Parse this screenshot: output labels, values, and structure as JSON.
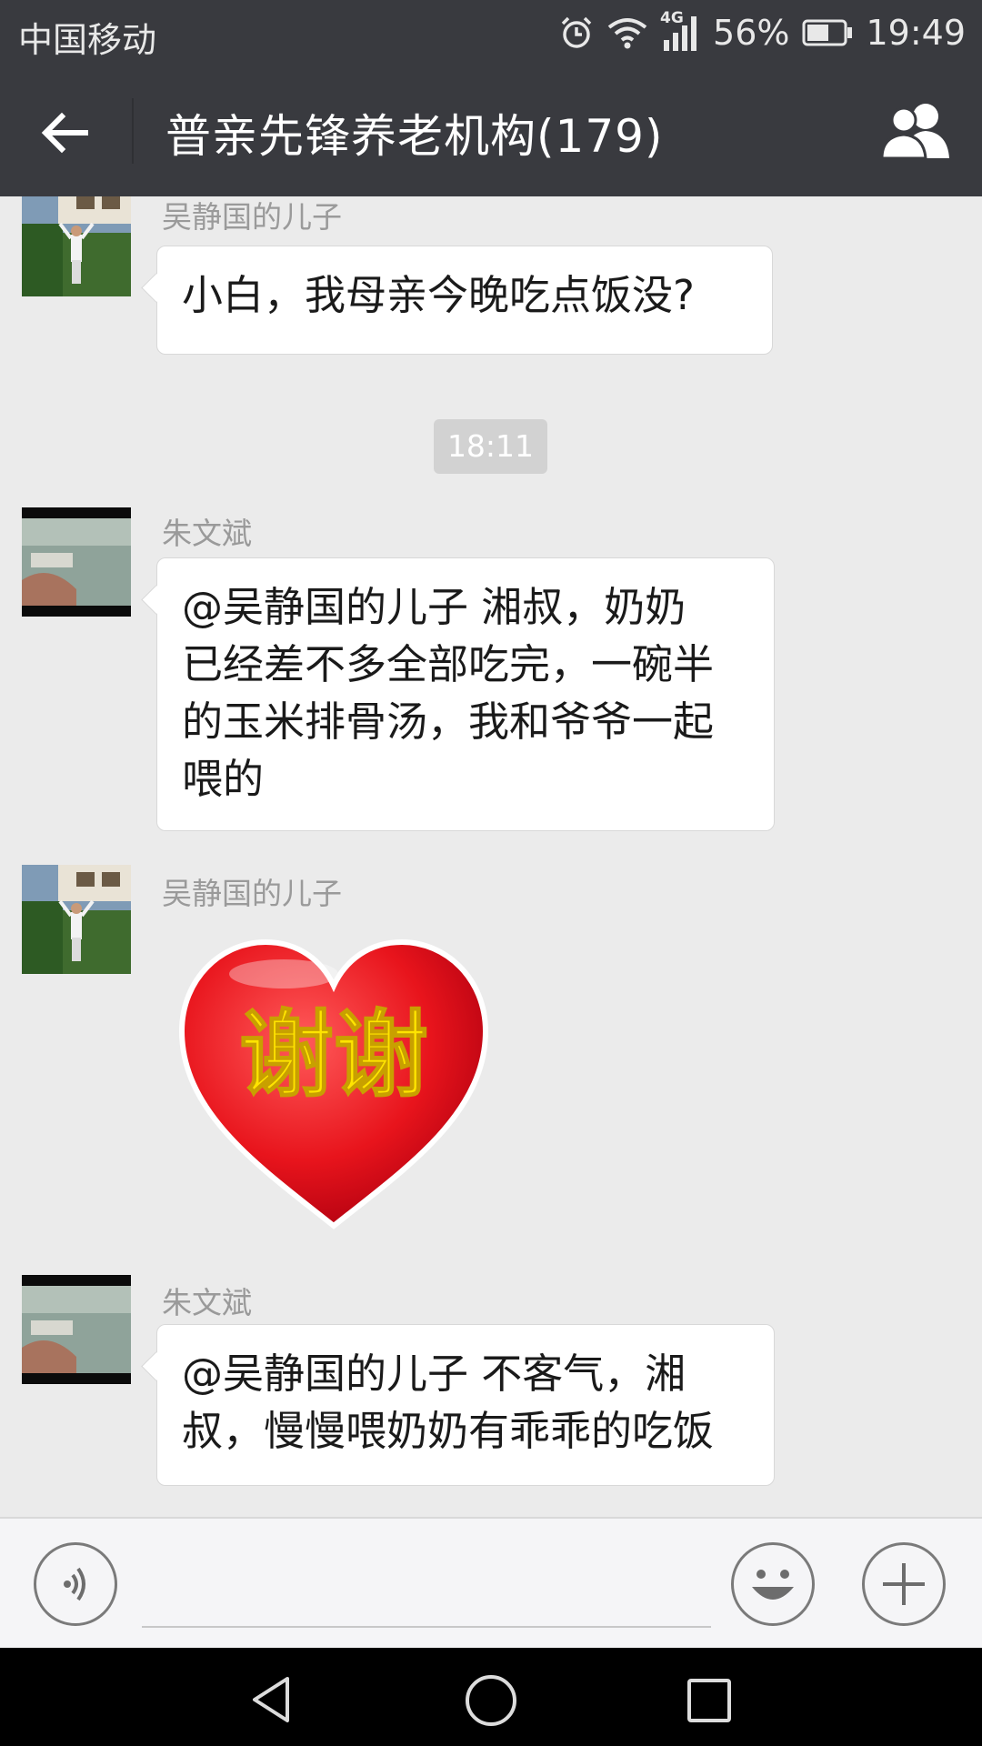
{
  "status_bar": {
    "carrier": "中国移动",
    "network": "4G",
    "battery": "56%",
    "time": "19:49",
    "icons": [
      "alarm-icon",
      "wifi-icon",
      "signal-icon",
      "battery-icon"
    ]
  },
  "header": {
    "title": "普亲先锋养老机构(179)",
    "back_icon": "back-arrow-icon",
    "group_icon": "group-members-icon"
  },
  "messages": [
    {
      "sender": "吴静国的儿子",
      "type": "text",
      "text": "小白，我母亲今晚吃点饭没?"
    },
    {
      "type": "timestamp",
      "text": "18:11"
    },
    {
      "sender": "朱文斌",
      "type": "text",
      "lines": [
        "@吴静国的儿子 湘叔，奶奶",
        "已经差不多全部吃完，一碗半",
        "的玉米排骨汤，我和爷爷一起",
        "喂的"
      ]
    },
    {
      "sender": "吴静国的儿子",
      "type": "sticker",
      "sticker_text": "谢谢"
    },
    {
      "sender": "朱文斌",
      "type": "text",
      "lines": [
        "@吴静国的儿子 不客气，湘",
        "叔，慢慢喂奶奶有乖乖的吃饭"
      ]
    }
  ],
  "input_bar": {
    "voice_icon": "voice-icon",
    "emoji_icon": "emoji-icon",
    "plus_icon": "plus-icon"
  },
  "nav_bar": {
    "icons": [
      "nav-back-icon",
      "nav-home-icon",
      "nav-recents-icon"
    ]
  },
  "colors": {
    "bar_bg": "#393a3f",
    "chat_bg": "#ebebeb",
    "bubble_bg": "#ffffff",
    "heart_red": "#e8141c",
    "sticker_text": "#ffe400"
  }
}
